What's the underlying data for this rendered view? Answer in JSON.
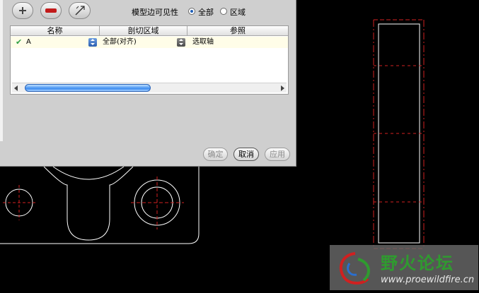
{
  "toolbar": {
    "add_icon": "plus-icon",
    "remove_icon": "minus-icon",
    "edit_icon": "edit-icon"
  },
  "visibility": {
    "label": "模型边可见性",
    "option_all": "全部",
    "option_region": "区域",
    "selected": "全部"
  },
  "table": {
    "columns": [
      "名称",
      "剖切区域",
      "参照"
    ],
    "rows": [
      {
        "name": "A",
        "region": "全部(对齐)",
        "reference": "选取轴"
      }
    ]
  },
  "buttons": {
    "ok": "确定",
    "cancel": "取消",
    "apply": "应用"
  },
  "watermark": {
    "title": "野火论坛",
    "url": "www.proewildfire.cn"
  },
  "colors": {
    "accent": "#1f5fb8",
    "check": "#2ea043",
    "drawing_lines": "#ffffff",
    "center_lines": "#d02020"
  }
}
